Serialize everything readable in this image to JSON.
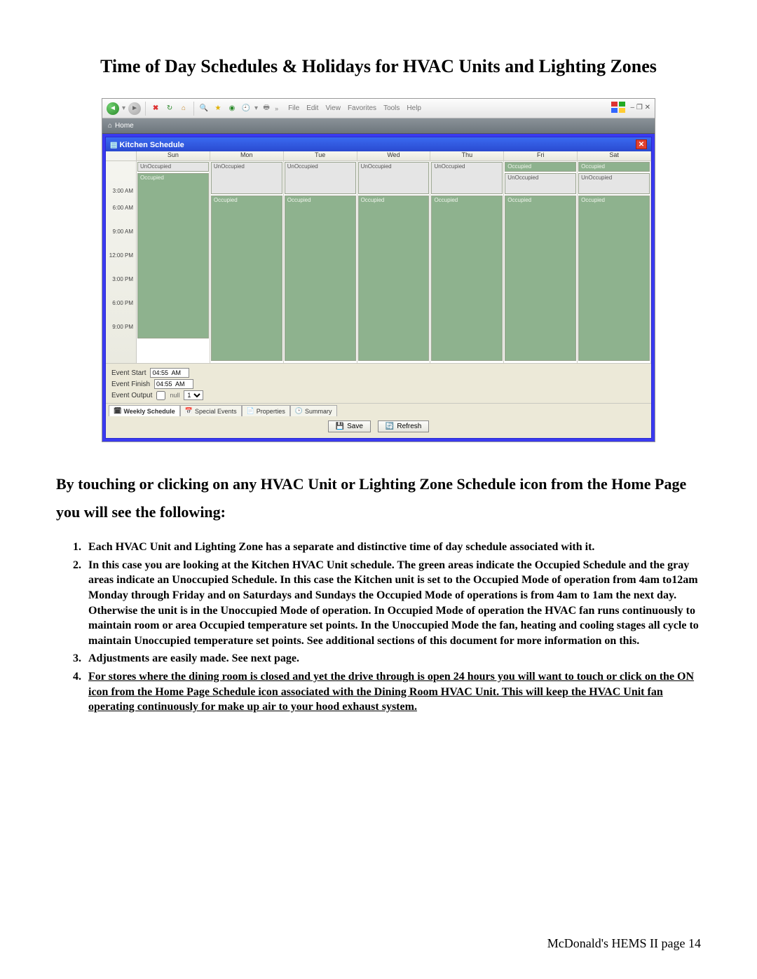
{
  "doc": {
    "title": "Time of Day Schedules & Holidays for HVAC Units and Lighting Zones",
    "lead": "By touching or clicking on any HVAC Unit or Lighting Zone Schedule icon from the Home Page you will see the following:",
    "items": [
      "Each HVAC Unit and Lighting Zone has a separate and distinctive time of day schedule associated with it.",
      "In this case you are looking at the Kitchen HVAC Unit schedule. The green areas indicate the Occupied Schedule and the gray areas indicate an Unoccupied Schedule. In this case the Kitchen unit is set to the Occupied Mode of operation from 4am to12am Monday through Friday and on Saturdays and Sundays the Occupied Mode of operations is from 4am to 1am the next day. Otherwise the unit is in the Unoccupied Mode of operation. In Occupied Mode of operation the HVAC fan runs continuously to maintain room or area Occupied temperature set points. In the Unoccupied Mode the fan, heating and cooling stages all cycle to maintain Unoccupied temperature set points. See additional sections of this document for more information on this.",
      "Adjustments are easily made. See next page.",
      "For stores where the dining room is closed and yet the drive through is open 24 hours you will want to touch or click on the ON icon from the Home Page Schedule icon associated with the Dining Room HVAC Unit. This will keep the HVAC Unit fan operating continuously for make up air to your hood exhaust system."
    ],
    "footer": "McDonald's HEMS II page 14"
  },
  "browser": {
    "menus": [
      "File",
      "Edit",
      "View",
      "Favorites",
      "Tools",
      "Help"
    ],
    "tab": "Home",
    "window_controls": "–  ❐  ✕"
  },
  "app": {
    "title": "Kitchen Schedule",
    "days": [
      "Sun",
      "Mon",
      "Tue",
      "Wed",
      "Thu",
      "Fri",
      "Sat"
    ],
    "times": [
      "3:00 AM",
      "6:00 AM",
      "9:00 AM",
      "12:00 PM",
      "3:00 PM",
      "6:00 PM",
      "9:00 PM"
    ],
    "labels": {
      "unocc": "UnOccupied",
      "occ": "Occupied"
    },
    "event": {
      "start_label": "Event Start",
      "finish_label": "Event Finish",
      "output_label": "Event Output",
      "start_val": "04:55  AM",
      "finish_val": "04:55  AM",
      "output_check": "null",
      "output_sel": "1"
    },
    "tabs": [
      "Weekly Schedule",
      "Special Events",
      "Properties",
      "Summary"
    ],
    "buttons": {
      "save": "Save",
      "refresh": "Refresh"
    }
  }
}
